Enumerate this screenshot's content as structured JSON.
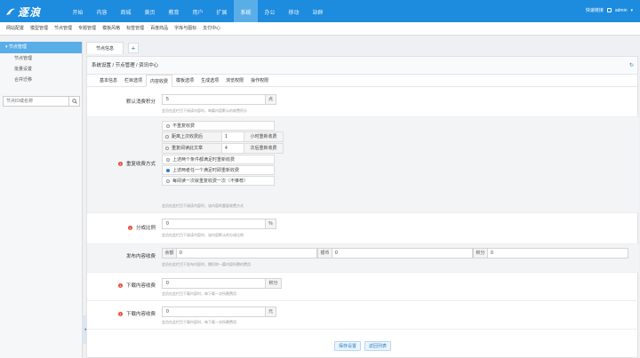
{
  "logo": {
    "text": "逐浪"
  },
  "topnav": [
    "开始",
    "内容",
    "商城",
    "黄页",
    "教育",
    "用户",
    "扩展",
    "系统",
    "办公",
    "移动",
    "站群"
  ],
  "topnav_active": 7,
  "toptools": {
    "quick": "快速链接",
    "user": "admin"
  },
  "subnav": [
    "网站配置",
    "模型管理",
    "节点管理",
    "专题管理",
    "模板风格",
    "标签管理",
    "百度商品",
    "字库与图标",
    "支付中心"
  ],
  "sidebar": {
    "title": "节点管理",
    "items": [
      "节点管理",
      "批量设置",
      "合并迁移"
    ],
    "search_placeholder": "节点ID或名称"
  },
  "tabbar": {
    "tab": "节点信息",
    "plus": "+"
  },
  "breadcrumb": {
    "a": "系统设置",
    "sep1": "/",
    "b": "节点管理",
    "sep2": "/",
    "c": "资讯中心"
  },
  "tabs": [
    "基本信息",
    "栏目选项",
    "内容收费",
    "模板选项",
    "生成选项",
    "浏览权限",
    "操作权限"
  ],
  "tabs_active": 2,
  "form": {
    "score": {
      "label": "默认消费积分",
      "value": "5",
      "unit": "点",
      "help": "会员在此栏目下阅读内容时，每篇内容默认的收费积分"
    },
    "repeat": {
      "badge": "1",
      "label": "重复收费方式",
      "opt0": "不重复收费",
      "opt1_label": "距离上次收费后",
      "opt1_value": "1",
      "opt1_unit": "小时重新收费",
      "opt2_label": "重复阅读此文章",
      "opt2_value": "4",
      "opt2_unit": "次后重新收费",
      "opt3": "上述两个条件都满足时重新收费",
      "opt4": "上述两者任一个满足时即重新收费",
      "opt5": "每阅读一次就重复收费一次（不推荐）",
      "help": "会员在此栏目下阅读内容时，该内容的重复收费方式"
    },
    "share": {
      "badge": "1",
      "label": "分成比例",
      "value": "0",
      "unit": "%",
      "help": "会员在此栏目下阅读内容时，该内容默认的分成比例"
    },
    "publish": {
      "label": "发布内容收费",
      "k1": "余额",
      "v1": "0",
      "k2": "银币",
      "v2": "0",
      "k3": "积分",
      "v3": "0",
      "help": "会员在此栏目下发布内容时，需扣除一篇内容所需的费用"
    },
    "download_score": {
      "badge": "1",
      "label": "下载内容收费",
      "value": "0",
      "unit": "积分",
      "help": "会员在此栏目下载内容时，每下载一次所需费用"
    },
    "download_cash": {
      "badge": "1",
      "label": "下载内容收费",
      "value": "0",
      "unit": "元",
      "help": "会员在此栏目下载内容时，每下载一次所需费用"
    }
  },
  "buttons": {
    "save": "保存设置",
    "back": "返回列表"
  }
}
